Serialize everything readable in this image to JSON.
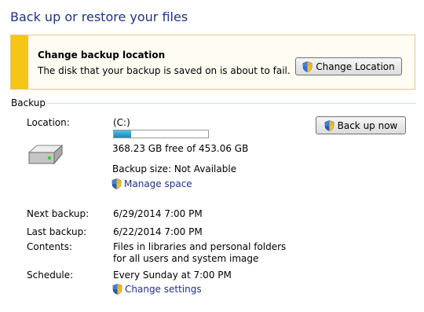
{
  "page_title": "Back up or restore your files",
  "warning": {
    "heading": "Change backup location",
    "message": "The disk that your backup is saved on is about to fail.",
    "button_label": "Change Location"
  },
  "backup_section": {
    "label": "Backup",
    "location_label": "Location:",
    "drive": "(C:)",
    "used_fraction": 0.187,
    "free_space": "368.23 GB free of 453.06 GB",
    "backup_size": "Backup size: Not Available",
    "manage_space_link": "Manage space",
    "back_up_now_button": "Back up now",
    "details": [
      {
        "label": "Next backup:",
        "value": "6/29/2014 7:00 PM"
      },
      {
        "label": "Last backup:",
        "value": "6/22/2014 7:00 PM"
      },
      {
        "label": "Contents:",
        "value": "Files in libraries and personal folders for all users and system image"
      },
      {
        "label": "Schedule:",
        "value": "Every Sunday at 7:00 PM"
      }
    ],
    "change_settings_link": "Change settings"
  },
  "colors": {
    "title": "#1e3287",
    "warning_stripe": "#f5c518",
    "progress_fill": "#1a87b8"
  },
  "icons": [
    "uac-shield-icon",
    "hard-drive-icon"
  ]
}
